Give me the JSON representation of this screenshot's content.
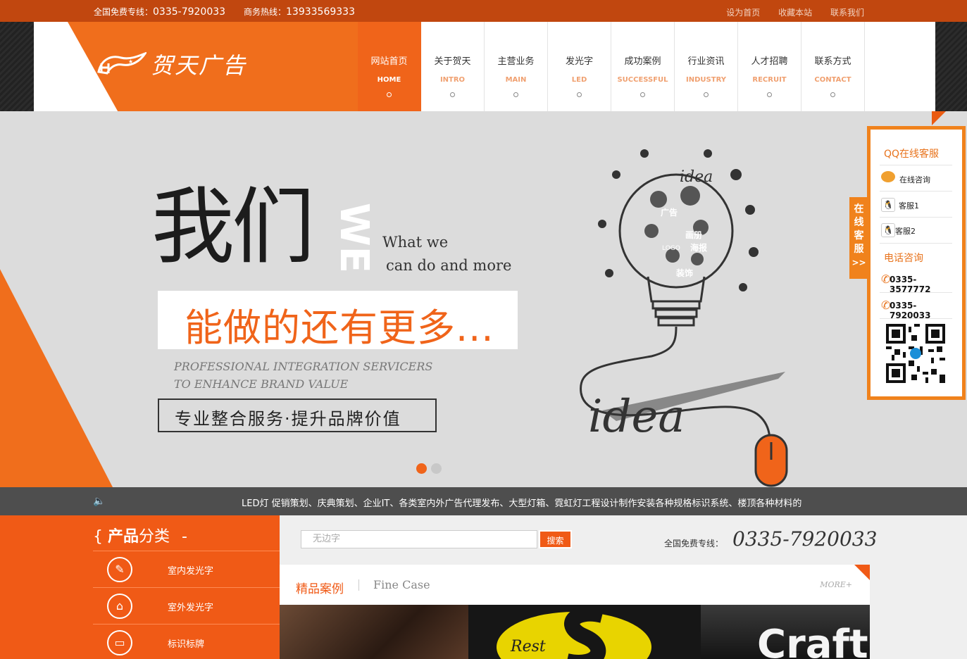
{
  "topbar": {
    "free_line_label": "全国免费专线：",
    "free_line_number": "0335-7920033",
    "business_line_label": "商务热线：",
    "business_line_number": "13933569333",
    "links": [
      "设为首页",
      "收藏本站",
      "联系我们"
    ]
  },
  "logo": {
    "text": "贺天广告"
  },
  "nav": [
    {
      "cn": "网站首页",
      "en": "HOME",
      "active": true
    },
    {
      "cn": "关于贺天",
      "en": "INTRO"
    },
    {
      "cn": "主营业务",
      "en": "MAIN"
    },
    {
      "cn": "发光字",
      "en": "LED"
    },
    {
      "cn": "成功案例",
      "en": "SUCCESSFUL"
    },
    {
      "cn": "行业资讯",
      "en": "INDUSTRY"
    },
    {
      "cn": "人才招聘",
      "en": "RECRUIT"
    },
    {
      "cn": "联系方式",
      "en": "CONTACT"
    }
  ],
  "banner": {
    "big": "我们",
    "we": "WE",
    "what_line1": "What we",
    "what_line2": "can do and more",
    "slogan": "能做的还有更多...",
    "prof_line1": "PROFESSIONAL INTEGRATION SERVICERS",
    "prof_line2": "TO ENHANCE BRAND VALUE",
    "service": "专业整合服务·提升品牌价值",
    "art_word": "idea",
    "bulb_words": [
      "广告",
      "画册",
      "海报",
      "装饰",
      "LOGO"
    ],
    "slides_total": 2,
    "slide_active": 1
  },
  "ticker": {
    "text": "LED灯 促销策划、庆典策划、企业IT、各类室内外广告代理发布、大型灯箱、霓虹灯工程设计制作安装各种规格标识系统、楼顶各种材料的"
  },
  "categories": {
    "title_brace": "{",
    "title_bold": "产品",
    "title_rest": "分类",
    "title_dash": "-",
    "items": [
      "室内发光字",
      "室外发光字",
      "标识标牌"
    ]
  },
  "search": {
    "placeholder": "无边字",
    "button": "搜索"
  },
  "hotline": {
    "label": "全国免费专线：",
    "number": "0335-7920033"
  },
  "cases": {
    "title": "精品案例",
    "title_en": "Fine Case",
    "more": "MORE+"
  },
  "service_panel": {
    "tab": "在线客服",
    "tab_arrow": ">>",
    "qq_title": "QQ在线客服",
    "consult": "在线咨询",
    "kf1": "客服1",
    "kf2": "客服2",
    "phone_title": "电话咨询",
    "phone1": "0335-3577772",
    "phone2": "0335-7920033"
  },
  "colors": {
    "brand": "#f0641a",
    "topbar": "#c1470f",
    "side": "#f0821c"
  }
}
